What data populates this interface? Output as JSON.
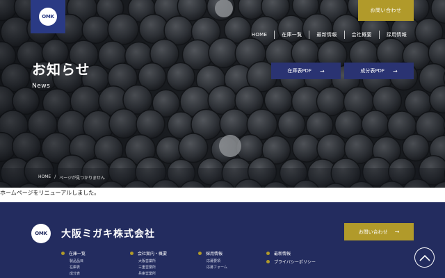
{
  "header": {
    "logo_text": "OMK",
    "contact_label": "お問い合わせ",
    "nav": [
      "HOME",
      "在庫一覧",
      "最新情報",
      "会社概要",
      "採用情報"
    ]
  },
  "hero": {
    "title": "お知らせ",
    "subtitle": "News",
    "pdf_buttons": [
      "在庫表PDF",
      "成分表PDF"
    ],
    "arrow_glyph": "→"
  },
  "breadcrumb": {
    "home": "HOME",
    "separator": "/",
    "current": "ページが見つかりません"
  },
  "content": {
    "text": "ホームページをリニューアルしました。"
  },
  "footer": {
    "logo_text": "OMK",
    "company_name": "大阪ミガキ株式会社",
    "contact_label": "お問い合わせ",
    "columns": [
      {
        "title": "在庫一覧",
        "items": [
          "製品品目",
          "在庫表",
          "成分表"
        ]
      },
      {
        "title": "会社案内・概要",
        "items": [
          "大阪営業所",
          "三重営業所",
          "兵庫営業所"
        ]
      },
      {
        "title": "採用情報",
        "items": [
          "応募要項",
          "応募フォーム"
        ]
      },
      {
        "title": "最新情報",
        "items": []
      },
      {
        "title": "プライバシーポリシー",
        "items": []
      }
    ]
  },
  "colors": {
    "brand_navy": "#2a3a84",
    "footer_bg": "#232c5f",
    "accent_gold": "#b19a2a",
    "pdf_button": "#2a3372"
  }
}
